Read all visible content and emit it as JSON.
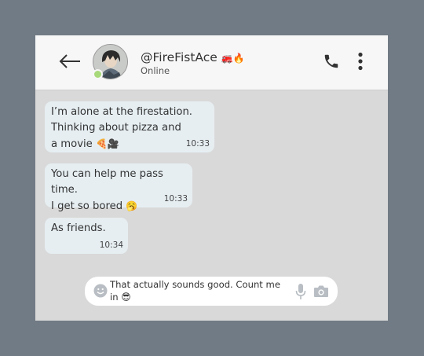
{
  "header": {
    "back_icon": "arrow-left-icon",
    "avatar_icon": "avatar-illustration",
    "username": "@FireFistAce",
    "username_emoji": "🚒🔥",
    "status": "Online",
    "call_icon": "phone-icon",
    "menu_icon": "more-vertical-icon"
  },
  "messages": [
    {
      "text": "I’m alone at the firestation.\nThinking about pizza and\na movie",
      "emoji": "🍕🎥",
      "time": "10:33"
    },
    {
      "text": "You can help me pass time.\nI get so bored",
      "emoji": "🥱",
      "time": "10:33"
    },
    {
      "text": "As friends.",
      "emoji": "",
      "time": "10:34"
    }
  ],
  "composer": {
    "smiley_icon": "smiley-icon",
    "text": "That actually sounds good. Count me in",
    "emoji": "😎",
    "mic_icon": "microphone-icon",
    "camera_icon": "camera-icon"
  },
  "colors": {
    "background": "#717b85",
    "chat_bg": "#d9d9d9",
    "header_bg": "#f7f7f7",
    "bubble_bg": "#e6eef2",
    "online": "#a8d97a"
  }
}
